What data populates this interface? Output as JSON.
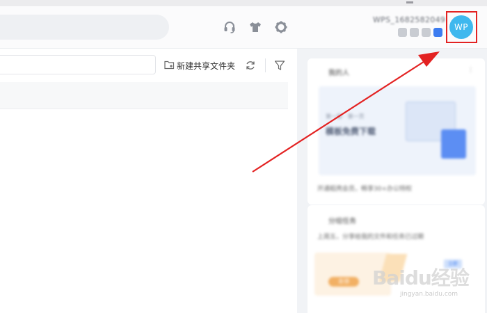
{
  "header": {
    "username": "WPS_1682582049",
    "avatar_initials": "WP",
    "icons": [
      "headset-icon",
      "tshirt-icon",
      "gear-icon"
    ]
  },
  "toolbar": {
    "new_shared_folder_label": "新建共享文件夹",
    "icons": [
      "folder-plus-icon",
      "refresh-icon",
      "filter-icon"
    ]
  },
  "side_cards": {
    "card1_title": "我的人",
    "card1_promo_line1": "第一版 · 第一页",
    "card1_promo_line2": "模板免费下载",
    "card1_footer": "开通稻壳会员，畅享30+办公特权",
    "card2_title": "分组任务",
    "card2_text": "上周五，分享给我的文件和任务已过期",
    "card2_gift_label": "去领",
    "card2_tag": "立即"
  },
  "watermark": {
    "brand": "Baidu经验",
    "url": "jingyan.baidu.com"
  },
  "colors": {
    "avatar": "#3fb8ee",
    "highlight": "#e32222",
    "badge_accent": "#3d7cf0",
    "panel_bg": "#f1f3f6"
  }
}
